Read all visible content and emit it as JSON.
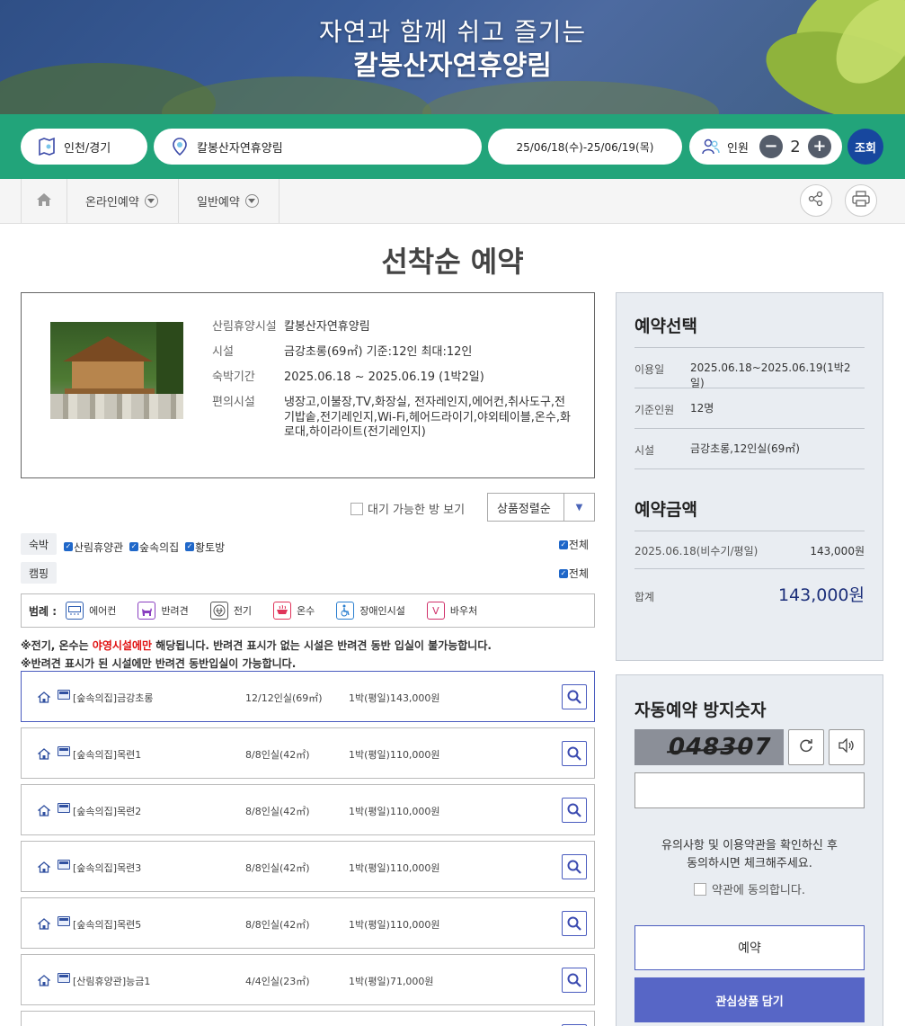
{
  "banner": {
    "subtitle": "자연과 함께 쉬고 즐기는",
    "title": "칼봉산자연휴양림"
  },
  "search": {
    "region": "인천/경기",
    "forest": "칼봉산자연휴양림",
    "dates": "25/06/18(수)-25/06/19(목)",
    "people_label": "인원",
    "people_count": "2",
    "minus": "−",
    "plus": "+",
    "submit_label": "조회"
  },
  "nav": {
    "items": [
      "온라인예약",
      "일반예약"
    ]
  },
  "page_title": "선착순 예약",
  "info": {
    "rows": [
      {
        "key": "산림휴양시설",
        "value": "칼봉산자연휴양림"
      },
      {
        "key": "시설",
        "value": "금강초롱(69㎡) 기준:12인 최대:12인"
      },
      {
        "key": "숙박기간",
        "value": "2025.06.18 ~ 2025.06.19 (1박2일)"
      },
      {
        "key": "편의시설",
        "value": "냉장고,이불장,TV,화장실, 전자레인지,에어컨,취사도구,전기밥솥,전기레인지,Wi-Fi,헤어드라이기,야외테이블,온수,화로대,하이라이트(전기레인지)"
      }
    ]
  },
  "filters": {
    "waiting_label": "대기 가능한 방 보기",
    "sort_value": "상품정렬순",
    "stay_tag": "숙박",
    "stay_options": [
      "산림휴양관",
      "숲속의집",
      "황토방"
    ],
    "camping_tag": "캠핑",
    "all_label": "전체"
  },
  "legend": {
    "title": "범례 :",
    "items": [
      {
        "icon": "air-conditioner-icon",
        "label": "에어컨",
        "color": "#2f5fb3"
      },
      {
        "icon": "pet-icon",
        "label": "반려견",
        "color": "#8a3fc0"
      },
      {
        "icon": "electric-icon",
        "label": "전기",
        "color": "#555555"
      },
      {
        "icon": "hot-water-icon",
        "label": "온수",
        "color": "#e0345a"
      },
      {
        "icon": "accessible-icon",
        "label": "장애인시설",
        "color": "#2a7fd0"
      },
      {
        "icon": "voucher-icon",
        "label": "바우처",
        "color": "#d0306a"
      }
    ]
  },
  "notes": {
    "line1_a": "※전기, 온수는 ",
    "line1_red": "야영시설에만",
    "line1_b": " 해당됩니다. 반려견 표시가 없는 시설은 반려견 동반 입실이 불가능합니다.",
    "line2": "※반려견 표시가 된 시설에만 반려견 동반입실이 가능합니다."
  },
  "rooms": [
    {
      "name": "[숲속의집]금강초롱",
      "capacity": "12/12인실(69㎡)",
      "price": "1박(평일)143,000원"
    },
    {
      "name": "[숲속의집]목련1",
      "capacity": "8/8인실(42㎡)",
      "price": "1박(평일)110,000원"
    },
    {
      "name": "[숲속의집]목련2",
      "capacity": "8/8인실(42㎡)",
      "price": "1박(평일)110,000원"
    },
    {
      "name": "[숲속의집]목련3",
      "capacity": "8/8인실(42㎡)",
      "price": "1박(평일)110,000원"
    },
    {
      "name": "[숲속의집]목련5",
      "capacity": "8/8인실(42㎡)",
      "price": "1박(평일)110,000원"
    },
    {
      "name": "[산림휴양관]능금1",
      "capacity": "4/4인실(23㎡)",
      "price": "1박(평일)71,000원"
    },
    {
      "name": "",
      "capacity": "",
      "price": ""
    }
  ],
  "selection": {
    "title": "예약선택",
    "use_date_label": "이용일",
    "use_date": "2025.06.18~2025.06.19(1박2일)",
    "base_people_label": "기준인원",
    "base_people": "12명",
    "facility_label": "시설",
    "facility": "금강초롱,12인실(69㎡)"
  },
  "amount": {
    "title": "예약금액",
    "line_label": "2025.06.18(비수기/평일)",
    "line_value": "143,000원",
    "total_label": "합계",
    "total_value": "143,000원",
    "total_color": "#1c2f7a"
  },
  "captcha": {
    "title": "자동예약 방지숫자",
    "code": "048307",
    "input_value": "",
    "agree_line1": "유의사항 및 이용약관을 확인하신 후",
    "agree_line2": "동의하시면 체크해주세요.",
    "agree_label": "약관에 동의합니다.",
    "reserve_label": "예약",
    "wishlist_label": "관심상품 담기"
  },
  "colors": {
    "search_bar": "#22a47a",
    "submit": "#17479e",
    "accent": "#5766c6"
  }
}
